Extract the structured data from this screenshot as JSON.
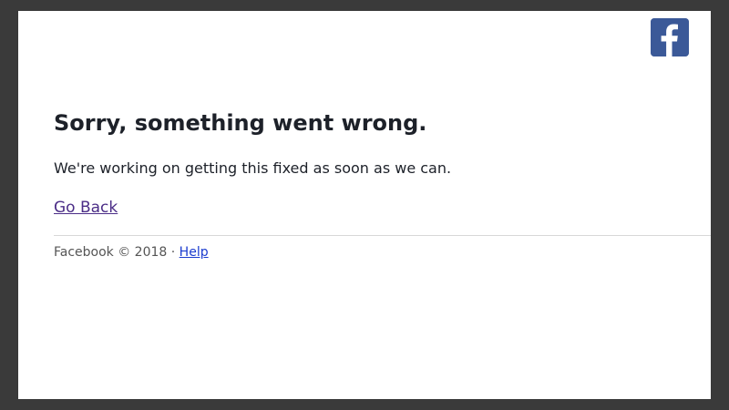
{
  "brand": {
    "logo_icon": "facebook-logo-icon",
    "logo_color": "#3b5998"
  },
  "error": {
    "title": "Sorry, something went wrong.",
    "message": "We're working on getting this fixed as soon as we can.",
    "go_back_label": "Go Back"
  },
  "footer": {
    "copyright": "Facebook © 2018",
    "separator": "·",
    "help_label": "Help"
  },
  "colors": {
    "title_text": "#1d2129",
    "visited_link": "#4b2d87",
    "link": "#1b3ccf"
  }
}
